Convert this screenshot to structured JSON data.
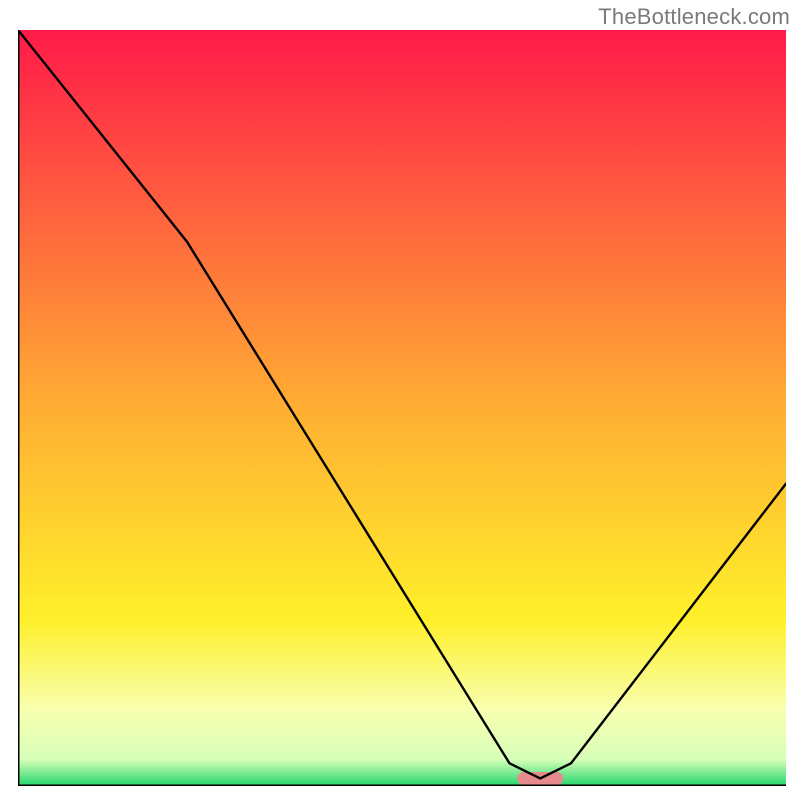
{
  "watermark": "TheBottleneck.com",
  "chart_data": {
    "type": "line",
    "title": "",
    "xlabel": "",
    "ylabel": "",
    "xlim": [
      0,
      100
    ],
    "ylim": [
      0,
      100
    ],
    "grid": false,
    "legend": false,
    "gradient_stops": [
      {
        "offset": 0.0,
        "color": "#ff1a49"
      },
      {
        "offset": 0.5,
        "color": "#ffae33"
      },
      {
        "offset": 0.78,
        "color": "#fff02a"
      },
      {
        "offset": 0.9,
        "color": "#f8ffb0"
      },
      {
        "offset": 0.965,
        "color": "#d6ffb8"
      },
      {
        "offset": 1.0,
        "color": "#22d66e"
      }
    ],
    "series": [
      {
        "name": "bottleneck-curve",
        "x": [
          0,
          22,
          64,
          68,
          72,
          100
        ],
        "values": [
          100,
          72,
          3,
          1,
          3,
          40
        ]
      }
    ],
    "marker": {
      "name": "highlight-pill",
      "x_center": 68,
      "y": 1,
      "width": 6,
      "color": "#e58b8b"
    }
  }
}
